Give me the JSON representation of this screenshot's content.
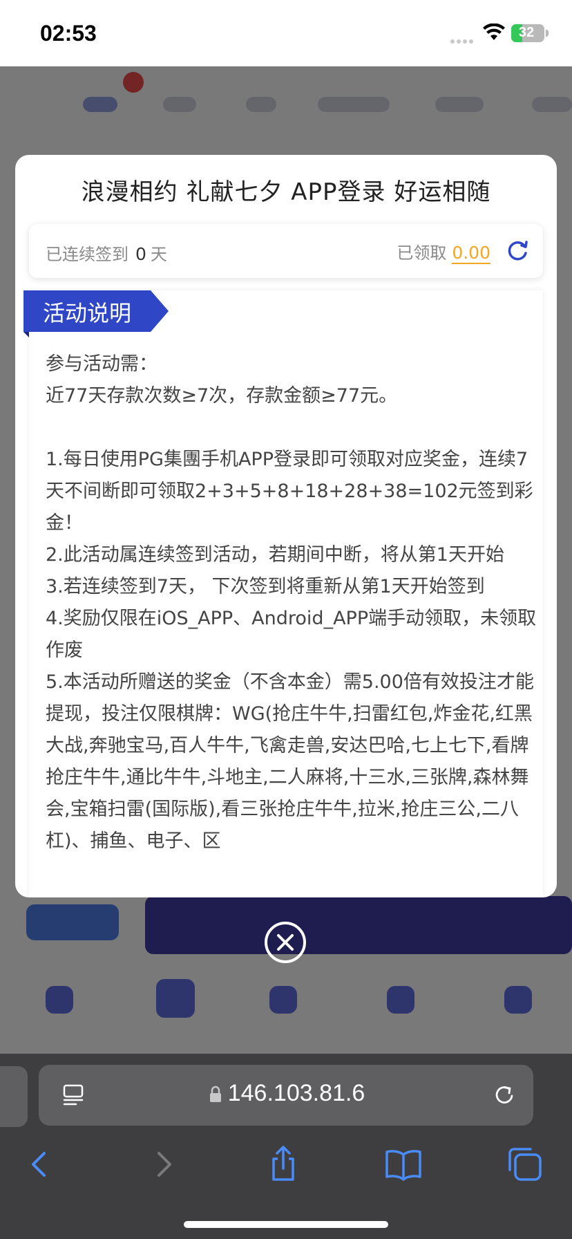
{
  "status_bar": {
    "time": "02:53",
    "battery": "32"
  },
  "modal": {
    "title": "浪漫相约 礼献七夕 APP登录 好运相随",
    "sign_in": {
      "streak_label": "已连续签到",
      "streak_count": "0",
      "streak_unit": "天",
      "received_label": "已领取",
      "received_amount": "0.00"
    },
    "rules_tag": "活动说明",
    "rules_text": "参与活动需：\n近77天存款次数≥7次，存款金额≥77元。\n\n1.每日使用PG集團手机APP登录即可领取对应奖金，连续7天不间断即可领取2+3+5+8+18+28+38=102元签到彩金！\n2.此活动属连续签到活动，若期间中断，将从第1天开始\n3.若连续签到7天， 下次签到将重新从第1天开始签到\n4.奖励仅限在iOS_APP、Android_APP端手动领取，未领取作废\n5.本活动所赠送的奖金（不含本金）需5.00倍有效投注才能提现，投注仅限棋牌：WG(抢庄牛牛,扫雷红包,炸金花,红黑大战,奔驰宝马,百人牛牛,飞禽走兽,安达巴哈,七上七下,看牌抢庄牛牛,通比牛牛,斗地主,二人麻将,十三水,三张牌,森林舞会,宝箱扫雷(国际版),看三张抢庄牛牛,拉米,抢庄三公,二八杠)、捕鱼、电子、区"
  },
  "browser": {
    "url": "146.103.81.6"
  },
  "colors": {
    "accent_blue": "#2f46c6",
    "amount_orange": "#f5a623"
  }
}
